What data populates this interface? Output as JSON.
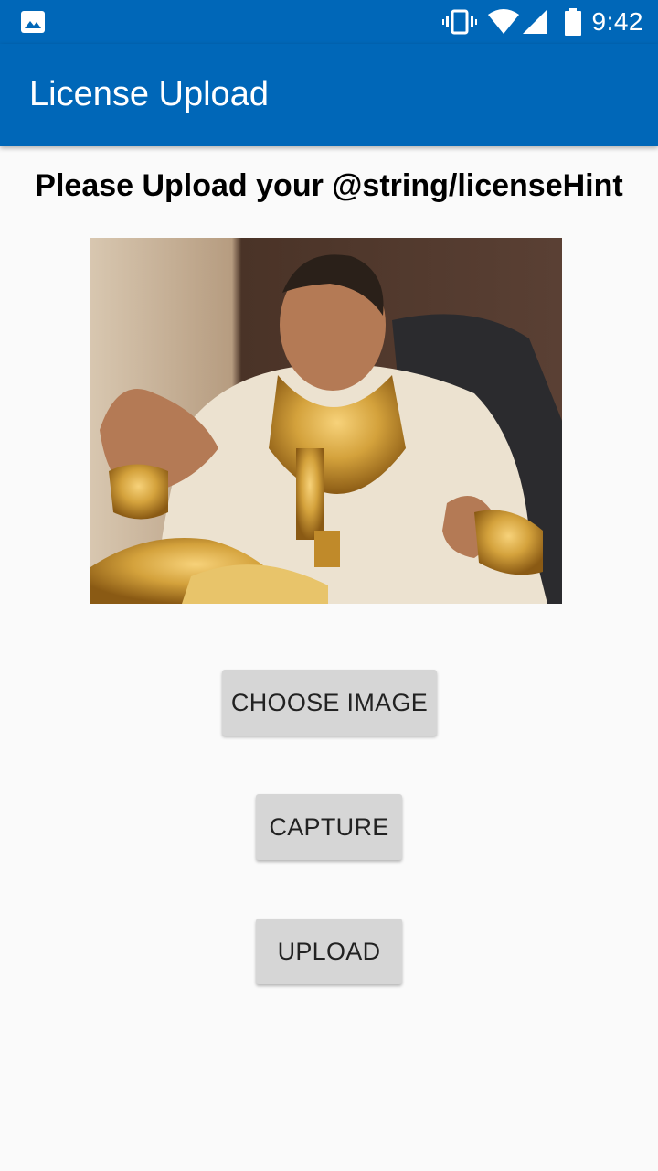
{
  "status_bar": {
    "time": "9:42",
    "icons": [
      "gallery-icon",
      "vibrate-icon",
      "wifi-icon",
      "signal-icon",
      "battery-icon"
    ]
  },
  "app_bar": {
    "title": "License Upload",
    "color": "#0067b8"
  },
  "main": {
    "heading": "Please Upload your @string/licenseHint",
    "image_alt": "uploaded photo",
    "buttons": {
      "choose": "CHOOSE IMAGE",
      "capture": "CAPTURE",
      "upload": "UPLOAD"
    }
  }
}
